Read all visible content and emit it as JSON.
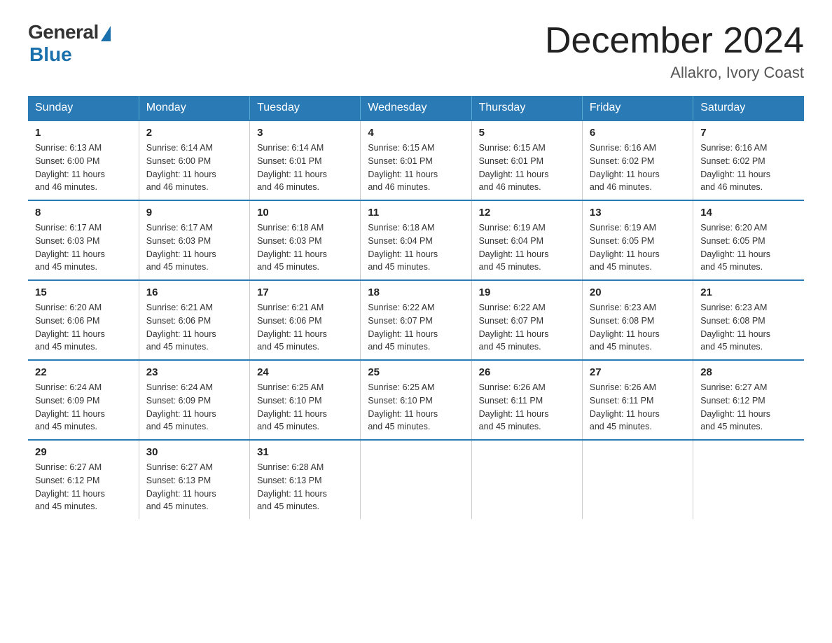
{
  "logo": {
    "general": "General",
    "blue": "Blue"
  },
  "title": "December 2024",
  "subtitle": "Allakro, Ivory Coast",
  "days_of_week": [
    "Sunday",
    "Monday",
    "Tuesday",
    "Wednesday",
    "Thursday",
    "Friday",
    "Saturday"
  ],
  "weeks": [
    [
      {
        "day": "1",
        "sunrise": "6:13 AM",
        "sunset": "6:00 PM",
        "daylight": "11 hours and 46 minutes."
      },
      {
        "day": "2",
        "sunrise": "6:14 AM",
        "sunset": "6:00 PM",
        "daylight": "11 hours and 46 minutes."
      },
      {
        "day": "3",
        "sunrise": "6:14 AM",
        "sunset": "6:01 PM",
        "daylight": "11 hours and 46 minutes."
      },
      {
        "day": "4",
        "sunrise": "6:15 AM",
        "sunset": "6:01 PM",
        "daylight": "11 hours and 46 minutes."
      },
      {
        "day": "5",
        "sunrise": "6:15 AM",
        "sunset": "6:01 PM",
        "daylight": "11 hours and 46 minutes."
      },
      {
        "day": "6",
        "sunrise": "6:16 AM",
        "sunset": "6:02 PM",
        "daylight": "11 hours and 46 minutes."
      },
      {
        "day": "7",
        "sunrise": "6:16 AM",
        "sunset": "6:02 PM",
        "daylight": "11 hours and 46 minutes."
      }
    ],
    [
      {
        "day": "8",
        "sunrise": "6:17 AM",
        "sunset": "6:03 PM",
        "daylight": "11 hours and 45 minutes."
      },
      {
        "day": "9",
        "sunrise": "6:17 AM",
        "sunset": "6:03 PM",
        "daylight": "11 hours and 45 minutes."
      },
      {
        "day": "10",
        "sunrise": "6:18 AM",
        "sunset": "6:03 PM",
        "daylight": "11 hours and 45 minutes."
      },
      {
        "day": "11",
        "sunrise": "6:18 AM",
        "sunset": "6:04 PM",
        "daylight": "11 hours and 45 minutes."
      },
      {
        "day": "12",
        "sunrise": "6:19 AM",
        "sunset": "6:04 PM",
        "daylight": "11 hours and 45 minutes."
      },
      {
        "day": "13",
        "sunrise": "6:19 AM",
        "sunset": "6:05 PM",
        "daylight": "11 hours and 45 minutes."
      },
      {
        "day": "14",
        "sunrise": "6:20 AM",
        "sunset": "6:05 PM",
        "daylight": "11 hours and 45 minutes."
      }
    ],
    [
      {
        "day": "15",
        "sunrise": "6:20 AM",
        "sunset": "6:06 PM",
        "daylight": "11 hours and 45 minutes."
      },
      {
        "day": "16",
        "sunrise": "6:21 AM",
        "sunset": "6:06 PM",
        "daylight": "11 hours and 45 minutes."
      },
      {
        "day": "17",
        "sunrise": "6:21 AM",
        "sunset": "6:06 PM",
        "daylight": "11 hours and 45 minutes."
      },
      {
        "day": "18",
        "sunrise": "6:22 AM",
        "sunset": "6:07 PM",
        "daylight": "11 hours and 45 minutes."
      },
      {
        "day": "19",
        "sunrise": "6:22 AM",
        "sunset": "6:07 PM",
        "daylight": "11 hours and 45 minutes."
      },
      {
        "day": "20",
        "sunrise": "6:23 AM",
        "sunset": "6:08 PM",
        "daylight": "11 hours and 45 minutes."
      },
      {
        "day": "21",
        "sunrise": "6:23 AM",
        "sunset": "6:08 PM",
        "daylight": "11 hours and 45 minutes."
      }
    ],
    [
      {
        "day": "22",
        "sunrise": "6:24 AM",
        "sunset": "6:09 PM",
        "daylight": "11 hours and 45 minutes."
      },
      {
        "day": "23",
        "sunrise": "6:24 AM",
        "sunset": "6:09 PM",
        "daylight": "11 hours and 45 minutes."
      },
      {
        "day": "24",
        "sunrise": "6:25 AM",
        "sunset": "6:10 PM",
        "daylight": "11 hours and 45 minutes."
      },
      {
        "day": "25",
        "sunrise": "6:25 AM",
        "sunset": "6:10 PM",
        "daylight": "11 hours and 45 minutes."
      },
      {
        "day": "26",
        "sunrise": "6:26 AM",
        "sunset": "6:11 PM",
        "daylight": "11 hours and 45 minutes."
      },
      {
        "day": "27",
        "sunrise": "6:26 AM",
        "sunset": "6:11 PM",
        "daylight": "11 hours and 45 minutes."
      },
      {
        "day": "28",
        "sunrise": "6:27 AM",
        "sunset": "6:12 PM",
        "daylight": "11 hours and 45 minutes."
      }
    ],
    [
      {
        "day": "29",
        "sunrise": "6:27 AM",
        "sunset": "6:12 PM",
        "daylight": "11 hours and 45 minutes."
      },
      {
        "day": "30",
        "sunrise": "6:27 AM",
        "sunset": "6:13 PM",
        "daylight": "11 hours and 45 minutes."
      },
      {
        "day": "31",
        "sunrise": "6:28 AM",
        "sunset": "6:13 PM",
        "daylight": "11 hours and 45 minutes."
      },
      null,
      null,
      null,
      null
    ]
  ],
  "labels": {
    "sunrise": "Sunrise:",
    "sunset": "Sunset:",
    "daylight": "Daylight:"
  }
}
